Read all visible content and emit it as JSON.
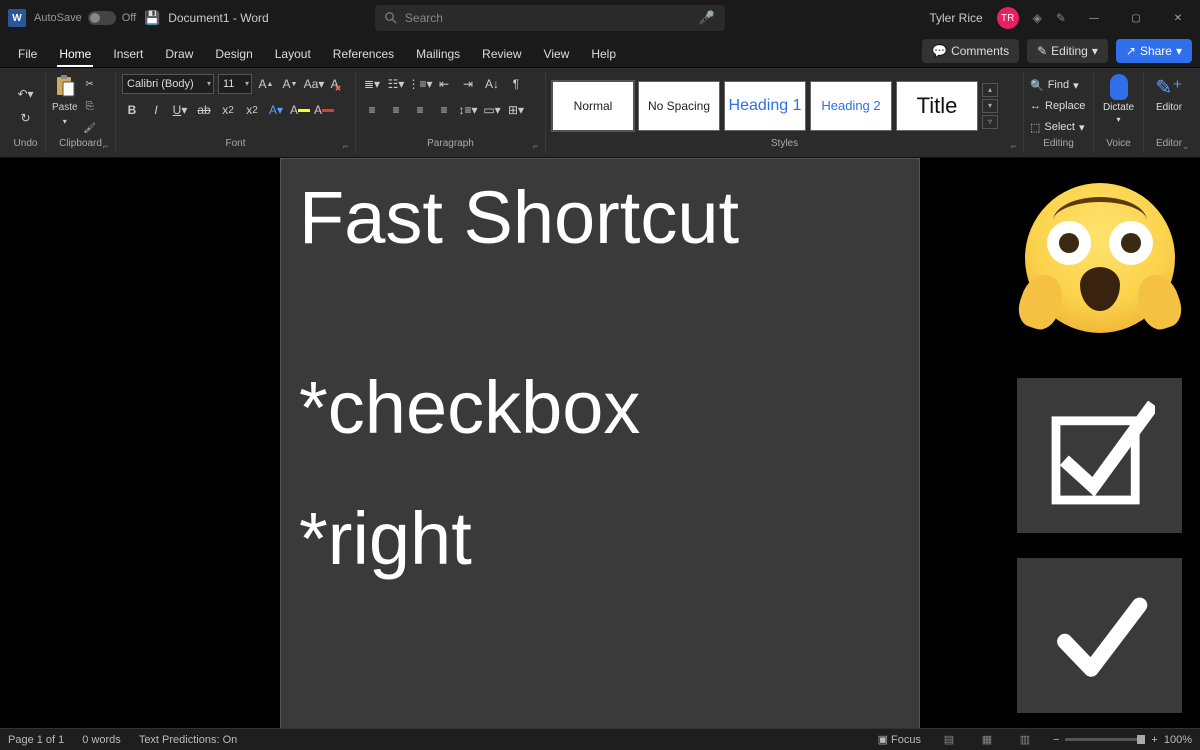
{
  "titlebar": {
    "autosave_label": "AutoSave",
    "autosave_state": "Off",
    "document_title": "Document1 - Word",
    "search_placeholder": "Search",
    "user_name": "Tyler Rice",
    "user_initials": "TR"
  },
  "tabs": {
    "file": "File",
    "home": "Home",
    "insert": "Insert",
    "draw": "Draw",
    "design": "Design",
    "layout": "Layout",
    "references": "References",
    "mailings": "Mailings",
    "review": "Review",
    "view": "View",
    "help": "Help",
    "comments": "Comments",
    "editing": "Editing",
    "share": "Share"
  },
  "ribbon": {
    "undo_label": "Undo",
    "clipboard_label": "Clipboard",
    "paste_label": "Paste",
    "font_label": "Font",
    "font_name": "Calibri (Body)",
    "font_size": "11",
    "paragraph_label": "Paragraph",
    "styles_label": "Styles",
    "style_normal": "Normal",
    "style_nospacing": "No Spacing",
    "style_h1": "Heading 1",
    "style_h2": "Heading 2",
    "style_title": "Title",
    "editing_label": "Editing",
    "find": "Find",
    "replace": "Replace",
    "select": "Select",
    "voice_label": "Voice",
    "dictate": "Dictate",
    "editor_label": "Editor",
    "editor": "Editor"
  },
  "document": {
    "line1": "Fast Shortcut",
    "line2": "*checkbox",
    "line3": "*right"
  },
  "status": {
    "page": "Page 1 of 1",
    "words": "0 words",
    "predictions": "Text Predictions: On",
    "focus": "Focus",
    "zoom": "100%"
  }
}
